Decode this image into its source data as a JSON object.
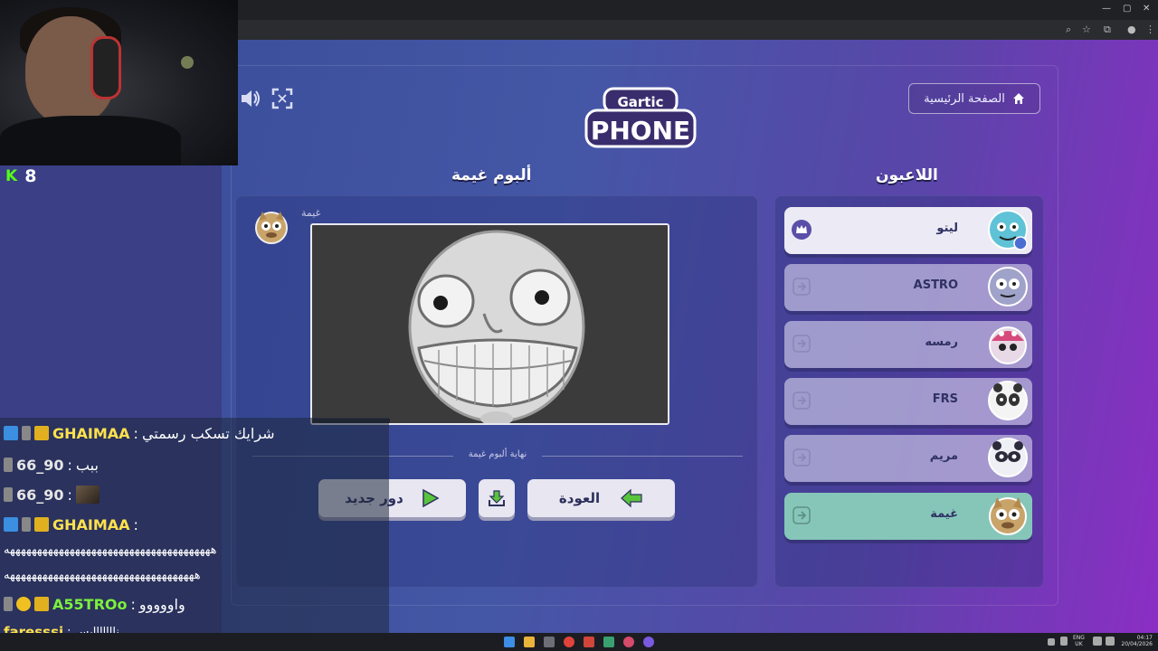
{
  "stream": {
    "viewer_icon": "kick-logo",
    "viewer_count": "8"
  },
  "header": {
    "home_label": "الصفحة الرئيسية",
    "logo_top": "Gartic",
    "logo_bottom": "PHONE"
  },
  "album": {
    "title": "ألبوم غيمة",
    "author": "غيمة",
    "end_text": "نهاية ألبوم غيمة",
    "new_round_label": "دور جديد",
    "back_label": "العودة"
  },
  "players": {
    "title": "اللاعبون",
    "list": [
      {
        "name": "ليتو",
        "role": "host",
        "color": "#eceaf4"
      },
      {
        "name": "ASTRO",
        "role": "player",
        "color": "#cfcde8"
      },
      {
        "name": "رمسه",
        "role": "player",
        "color": "#cfcde8"
      },
      {
        "name": "FRS",
        "role": "player",
        "color": "#cfcde8"
      },
      {
        "name": "مريم",
        "role": "player",
        "color": "#cfcde8"
      },
      {
        "name": "غيمة",
        "role": "self",
        "color": "#86c6b9"
      }
    ]
  },
  "chat": {
    "messages": [
      {
        "user": "GHAIMAA",
        "text": "شرايك تسكب رسمتي"
      },
      {
        "user": "66_90",
        "text": "ببب"
      },
      {
        "user": "66_90",
        "text": ""
      },
      {
        "user": "GHAIMAA",
        "text": ""
      },
      {
        "user": "",
        "text": "ههههههههههههههههههههههههههههههههههههههه"
      },
      {
        "user": "",
        "text": "هههههههههههههههههههههههههههههههههههه"
      },
      {
        "user": "A55TROo",
        "text": "واووووو"
      },
      {
        "user": "faresssj",
        "text": "نااااااايس"
      }
    ]
  },
  "taskbar": {
    "lang_line1": "ENG",
    "lang_line2": "UK",
    "time": "04:17",
    "date": "20/04/2026"
  },
  "colors": {
    "kick_green": "#53fc18",
    "host_row": "#eceaf4",
    "self_row": "#86c6b9",
    "button_bg": "#e7e6f1",
    "arrow_green": "#58c43c"
  }
}
